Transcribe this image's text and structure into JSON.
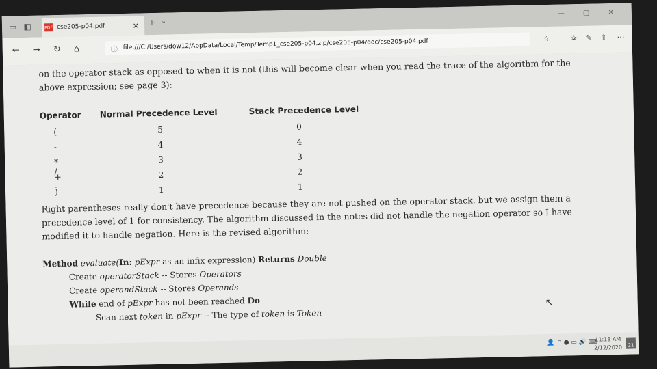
{
  "browser": {
    "tab_title": "cse205-p04.pdf",
    "url": "file:///C:/Users/dow12/AppData/Local/Temp/Temp1_cse205-p04.zip/cse205-p04/doc/cse205-p04.pdf"
  },
  "document": {
    "para1": "on the operator stack as opposed to when it is not (this will become clear when you read the trace of the algorithm for the above expression; see page 3):",
    "table": {
      "headers": [
        "Operator",
        "Normal Precedence Level",
        "Stack Precedence Level"
      ],
      "rows": [
        [
          "(",
          "5",
          "0"
        ],
        [
          "-",
          "4",
          "4"
        ],
        [
          "* /",
          "3",
          "3"
        ],
        [
          "+ -",
          "2",
          "2"
        ],
        [
          ")",
          "1",
          "1"
        ]
      ]
    },
    "para2": "Right parentheses really don't have precedence because they are not pushed on the operator stack, but we assign them a precedence level of 1 for consistency. The algorithm discussed in the notes did not handle the negation operator so I have modified it to handle negation. Here is the revised algorithm:",
    "algorithm": {
      "line1": {
        "kw1": "Method",
        "name": "evaluate(",
        "kw2": "In:",
        "param": "pExpr",
        "desc": "as an infix expression)",
        "kw3": "Returns",
        "ret": "Double"
      },
      "line2": {
        "pre": "Create",
        "var": "operatorStack",
        "sep": "--",
        "desc": "Stores",
        "type": "Operators"
      },
      "line3": {
        "pre": "Create",
        "var": "operandStack",
        "sep": "--",
        "desc": "Stores",
        "type": "Operands"
      },
      "line4": {
        "kw1": "While",
        "pre": "end of",
        "var": "pExpr",
        "desc": "has not been reached",
        "kw2": "Do"
      },
      "line5": {
        "pre": "Scan next",
        "var1": "token",
        "mid": "in",
        "var2": "pExpr",
        "sep": "--",
        "desc": "The type of",
        "var3": "token",
        "is": "is",
        "type": "Token"
      }
    }
  },
  "taskbar": {
    "time": "11:18 AM",
    "date": "2/12/2020",
    "notification_count": "21"
  }
}
